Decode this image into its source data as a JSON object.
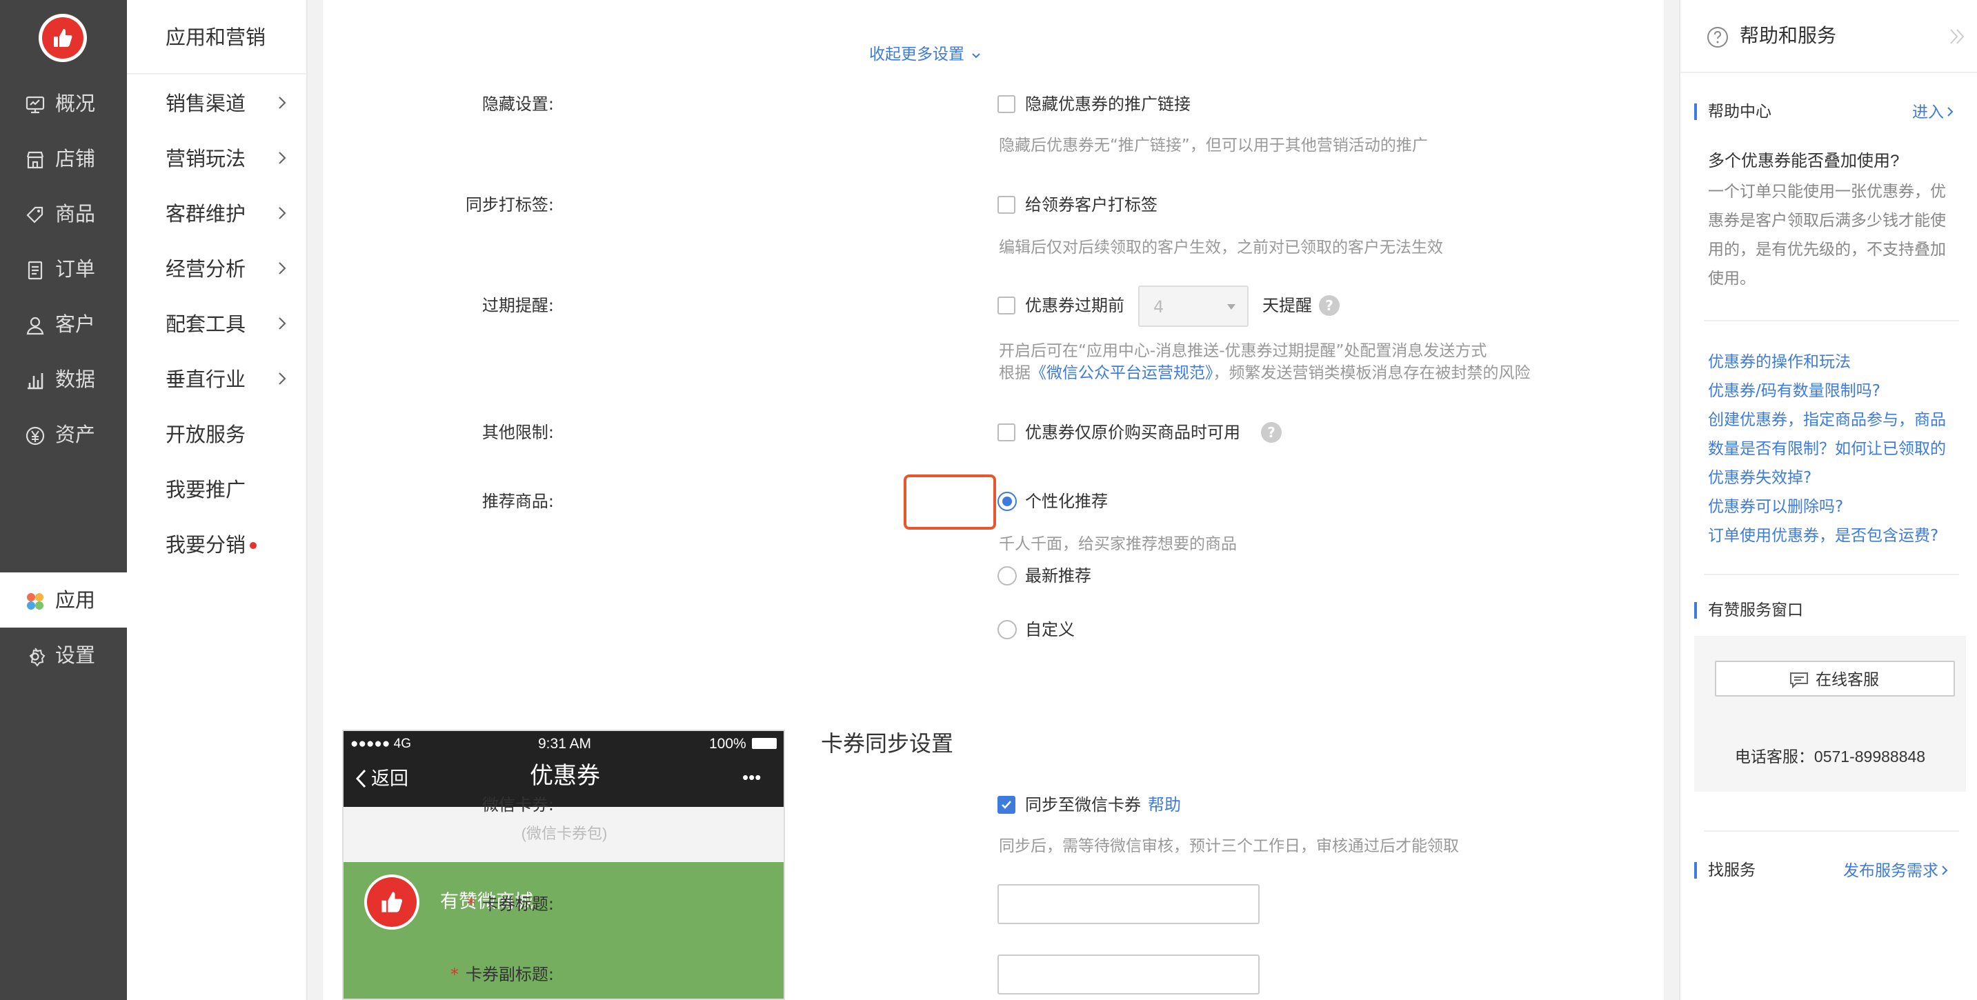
{
  "primary_nav": {
    "items": [
      {
        "label": "概况",
        "icon": "overview-icon"
      },
      {
        "label": "店铺",
        "icon": "store-icon"
      },
      {
        "label": "商品",
        "icon": "tag-icon"
      },
      {
        "label": "订单",
        "icon": "order-icon"
      },
      {
        "label": "客户",
        "icon": "user-icon"
      },
      {
        "label": "数据",
        "icon": "chart-icon"
      },
      {
        "label": "资产",
        "icon": "yen-icon"
      },
      {
        "label": "应用",
        "icon": "apps-icon",
        "active": true
      },
      {
        "label": "设置",
        "icon": "gear-icon"
      }
    ]
  },
  "secondary_nav": {
    "title": "应用和营销",
    "items": [
      {
        "label": "销售渠道",
        "has_arrow": true
      },
      {
        "label": "营销玩法",
        "has_arrow": true
      },
      {
        "label": "客群维护",
        "has_arrow": true
      },
      {
        "label": "经营分析",
        "has_arrow": true
      },
      {
        "label": "配套工具",
        "has_arrow": true
      },
      {
        "label": "垂直行业",
        "has_arrow": true
      },
      {
        "label": "开放服务",
        "has_arrow": false
      },
      {
        "label": "我要推广",
        "has_arrow": false
      },
      {
        "label": "我要分销",
        "has_arrow": false,
        "dot": true
      }
    ]
  },
  "form": {
    "collapse_link": "收起更多设置",
    "hide_setting": {
      "label": "隐藏设置:",
      "checkbox_label": "隐藏优惠券的推广链接",
      "checked": false,
      "help": "隐藏后优惠券无“推广链接”，但可以用于其他营销活动的推广"
    },
    "sync_tag": {
      "label": "同步打标签:",
      "checkbox_label": "给领券客户打标签",
      "checked": false,
      "help": "编辑后仅对后续领取的客户生效，之前对已领取的客户无法生效"
    },
    "expiry_reminder": {
      "label": "过期提醒:",
      "checkbox_label": "优惠券过期前",
      "checked": false,
      "days_value": "4",
      "suffix": "天提醒",
      "help_line1": "开启后可在“应用中心-消息推送-优惠券过期提醒”处配置消息发送方式",
      "help_line2_prefix": "根据",
      "help_line2_link": "《微信公众平台运营规范》",
      "help_line2_suffix": "，频繁发送营销类模板消息存在被封禁的风险"
    },
    "other_limits": {
      "label": "其他限制:",
      "checkbox_label": "优惠券仅原价购买商品时可用",
      "checked": false
    },
    "recommend": {
      "label": "推荐商品:",
      "highlight_color": "#e5582d",
      "options": [
        {
          "label": "个性化推荐",
          "selected": true
        },
        {
          "label": "最新推荐",
          "selected": false
        },
        {
          "label": "自定义",
          "selected": false
        }
      ],
      "option1_help": "千人千面，给买家推荐想要的商品"
    },
    "card_sync": {
      "section_title": "卡券同步设置",
      "wechat_card": {
        "label": "微信卡券:",
        "checkbox_label": "同步至微信卡券",
        "checked": true,
        "help_link": "帮助",
        "help": "同步后，需等待微信审核，预计三个工作日，审核通过后才能领取"
      },
      "card_title": {
        "label": "卡券标题:",
        "value": ""
      },
      "card_subtitle": {
        "label": "卡券副标题:",
        "value": ""
      }
    }
  },
  "phone_preview": {
    "signal": "●●●●● 4G",
    "time": "9:31 AM",
    "battery": "100%",
    "back_label": "返回",
    "title": "优惠券",
    "more": "•••",
    "subheader": "(微信卡券包)",
    "shop_name": "有赞微商城",
    "card_color": "#76ae60"
  },
  "help_panel": {
    "title": "帮助和服务",
    "help_center": {
      "title": "帮助中心",
      "enter_link": "进入",
      "question": "多个优惠券能否叠加使用?",
      "answer_lines": [
        "一个订单只能使用一张优惠券，优",
        "惠券是客户领取后满多少钱才能使",
        "用的，是有优先级的，不支持叠加",
        "使用。"
      ],
      "links": [
        "优惠券的操作和玩法",
        "优惠券/码有数量限制吗?",
        "创建优惠券，指定商品参与，商品",
        "数量是否有限制？如何让已领取的",
        "优惠券失效掉?",
        "优惠券可以删除吗?",
        "订单使用优惠券，是否包含运费?"
      ]
    },
    "service_window": {
      "title": "有赞服务窗口",
      "online_button": "在线客服",
      "phone_label": "电话客服：0571-89988848"
    },
    "find_service": {
      "title": "找服务",
      "publish_link": "发布服务需求"
    }
  }
}
